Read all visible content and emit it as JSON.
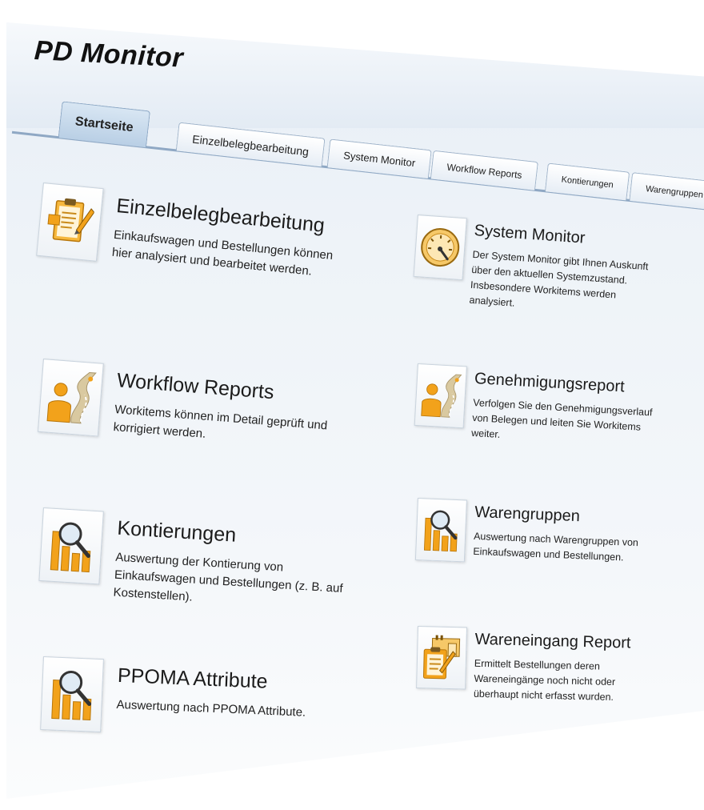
{
  "app": {
    "title": "PD Monitor"
  },
  "tabs": [
    {
      "label": "Startseite",
      "active": true
    },
    {
      "label": "Einzelbelegbearbeitung"
    },
    {
      "label": "System Monitor"
    },
    {
      "label": "Workflow Reports"
    },
    {
      "label": "Kontierungen"
    },
    {
      "label": "Warengruppen"
    }
  ],
  "cards": {
    "einzelbeleg": {
      "title": "Einzelbelegbearbeitung",
      "desc": "Einkaufswagen und Bestellungen können hier analysiert und bearbeitet werden.",
      "icon": "clipboard-edit-icon"
    },
    "workflow": {
      "title": "Workflow Reports",
      "desc": "Workitems können im Detail geprüft und korrigiert werden.",
      "icon": "person-road-icon"
    },
    "kontierungen": {
      "title": "Kontierungen",
      "desc": "Auswertung der Kontierung von Einkaufswagen und Bestellungen (z. B. auf Kostenstellen).",
      "icon": "chart-magnifier-icon"
    },
    "ppoma": {
      "title": "PPOMA Attribute",
      "desc": "Auswertung nach PPOMA Attribute.",
      "icon": "chart-magnifier-icon"
    },
    "systemmonitor": {
      "title": "System Monitor",
      "desc": "Der System Monitor gibt Ihnen Auskunft über den aktuellen Systemzustand. Insbesondere Workitems werden analysiert.",
      "icon": "gauge-icon"
    },
    "genehmigung": {
      "title": "Genehmigungsreport",
      "desc": "Verfolgen Sie den Genehmigungsverlauf von Belegen und leiten Sie Workitems weiter.",
      "icon": "person-road-icon"
    },
    "warengruppen": {
      "title": "Warengruppen",
      "desc": "Auswertung nach Warengruppen von Einkaufswagen und Bestellungen.",
      "icon": "chart-magnifier-icon"
    },
    "wareneingang": {
      "title": "Wareneingang Report",
      "desc": "Ermittelt Bestellungen deren Wareneingänge noch nicht oder überhaupt nicht erfasst wurden.",
      "icon": "warehouse-clipboard-icon"
    }
  },
  "colors": {
    "accent": "#f2a21b",
    "accent_dark": "#b8760a",
    "tab_border": "#8aa6c4"
  }
}
